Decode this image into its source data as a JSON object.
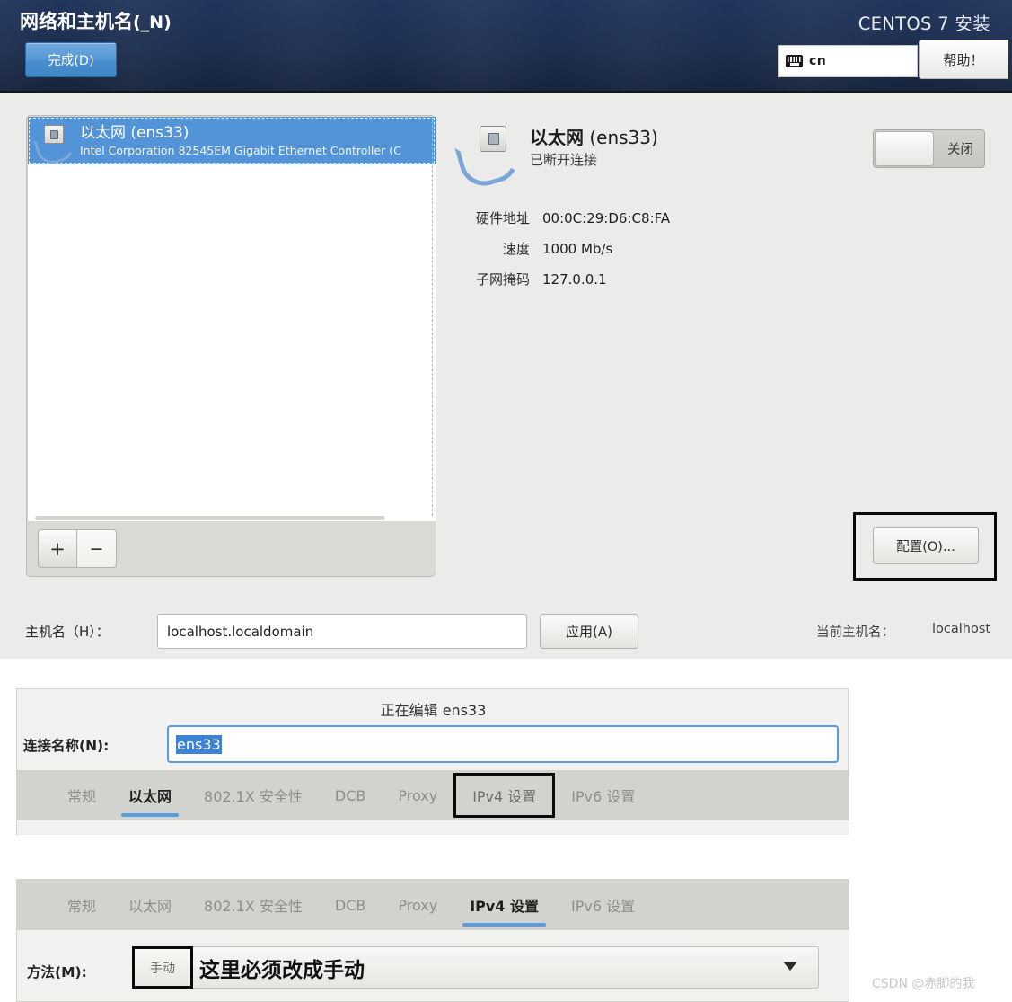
{
  "header": {
    "spoke_title": "网络和主机名",
    "spoke_title_mnemonic": "(_N)",
    "done_label": "完成(D)",
    "product_title": "CENTOS 7 安装",
    "keyboard_layout": "cn",
    "keyboard_icon": "keyboard-icon",
    "help_label": "帮助！"
  },
  "device_list": {
    "items": [
      {
        "name_kind": "以太网",
        "name_id": " (ens33)",
        "description": "Intel Corporation 82545EM Gigabit Ethernet Controller (C",
        "icon": "ethernet-icon",
        "selected": true
      }
    ],
    "add_label": "+",
    "remove_label": "−"
  },
  "detail": {
    "icon": "ethernet-icon",
    "title_kind": "以太网",
    "title_id": " (ens33)",
    "status": "已断开连接",
    "rows": [
      {
        "label": "硬件地址",
        "value": "00:0C:29:D6:C8:FA"
      },
      {
        "label": "速度",
        "value": "1000 Mb/s"
      },
      {
        "label": "子网掩码",
        "value": "127.0.0.1"
      }
    ],
    "toggle_state": "关闭",
    "configure_label": "配置(O)..."
  },
  "hostname": {
    "label": "主机名（H）：",
    "value": "localhost.localdomain",
    "apply_label": "应用(A)",
    "current_label": "当前主机名：",
    "current_value": "localhost"
  },
  "edit_dialog": {
    "title": "正在编辑 ens33",
    "connection_name_label": "连接名称(N):",
    "connection_name_value": "ens33",
    "tabs": [
      {
        "label": "常规",
        "active": false,
        "boxed": false
      },
      {
        "label": "以太网",
        "active": true,
        "boxed": false
      },
      {
        "label": "802.1X 安全性",
        "active": false,
        "boxed": false
      },
      {
        "label": "DCB",
        "active": false,
        "boxed": false
      },
      {
        "label": "Proxy",
        "active": false,
        "boxed": false
      },
      {
        "label": "IPv4 设置",
        "active": false,
        "boxed": true
      },
      {
        "label": "IPv6 设置",
        "active": false,
        "boxed": false
      }
    ]
  },
  "ipv4_panel": {
    "tabs": [
      {
        "label": "常规",
        "active": false,
        "boxed": false
      },
      {
        "label": "以太网",
        "active": false,
        "boxed": false
      },
      {
        "label": "802.1X 安全性",
        "active": false,
        "boxed": false
      },
      {
        "label": "DCB",
        "active": false,
        "boxed": false
      },
      {
        "label": "Proxy",
        "active": false,
        "boxed": false
      },
      {
        "label": "IPv4 设置",
        "active": true,
        "boxed": false
      },
      {
        "label": "IPv6 设置",
        "active": false,
        "boxed": false
      }
    ],
    "method_label": "方法(M):",
    "method_value": "手动",
    "annotation": "这里必须改成手动",
    "arrow_icon": "chevron-down-icon"
  },
  "watermark": "CSDN @赤脚的我",
  "colors": {
    "header_bg": "#1d2e4f",
    "accent_blue": "#5294d7",
    "selection_blue": "#3d82d4",
    "panel_bg": "#ebebe9",
    "tabstrip_bg": "#d2d2cf",
    "highlight_box": "#0a0a0a"
  }
}
